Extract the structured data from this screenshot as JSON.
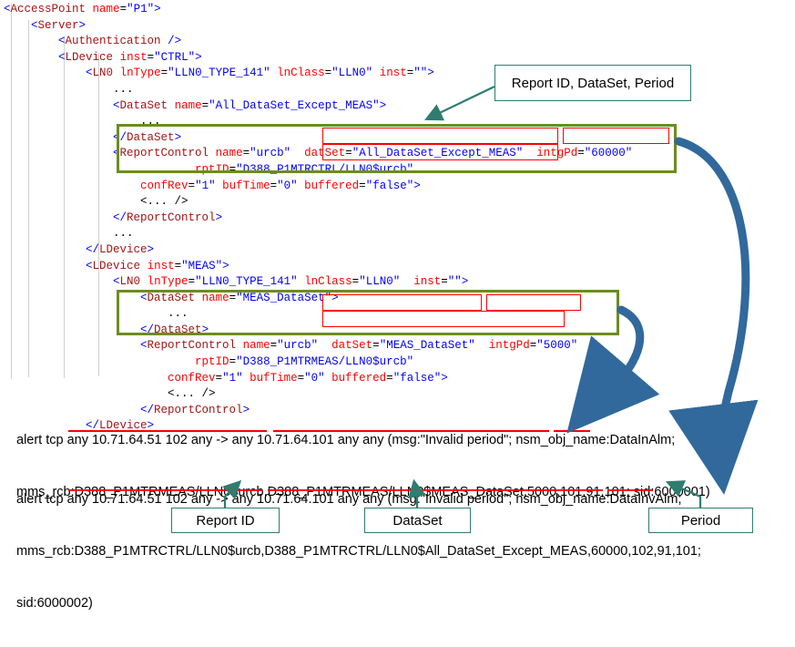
{
  "code_lines": [
    {
      "indent": 0,
      "segments": [
        {
          "t": "<",
          "c": "brk"
        },
        {
          "t": "AccessPoint",
          "c": "tag"
        },
        {
          "t": " ",
          "c": "plain"
        },
        {
          "t": "name",
          "c": "attr"
        },
        {
          "t": "=",
          "c": "plain"
        },
        {
          "t": "\"P1\"",
          "c": "val"
        },
        {
          "t": ">",
          "c": "brk"
        }
      ]
    },
    {
      "indent": 1,
      "segments": [
        {
          "t": "<",
          "c": "brk"
        },
        {
          "t": "Server",
          "c": "tag"
        },
        {
          "t": ">",
          "c": "brk"
        }
      ]
    },
    {
      "indent": 2,
      "segments": [
        {
          "t": "<",
          "c": "brk"
        },
        {
          "t": "Authentication",
          "c": "tag"
        },
        {
          "t": " />",
          "c": "brk"
        }
      ]
    },
    {
      "indent": 2,
      "segments": [
        {
          "t": "<",
          "c": "brk"
        },
        {
          "t": "LDevice",
          "c": "tag"
        },
        {
          "t": " ",
          "c": "plain"
        },
        {
          "t": "inst",
          "c": "attr"
        },
        {
          "t": "=",
          "c": "plain"
        },
        {
          "t": "\"CTRL\"",
          "c": "val"
        },
        {
          "t": ">",
          "c": "brk"
        }
      ]
    },
    {
      "indent": 3,
      "segments": [
        {
          "t": "<",
          "c": "brk"
        },
        {
          "t": "LN0",
          "c": "tag"
        },
        {
          "t": " ",
          "c": "plain"
        },
        {
          "t": "lnType",
          "c": "attr"
        },
        {
          "t": "=",
          "c": "plain"
        },
        {
          "t": "\"LLN0_TYPE_141\"",
          "c": "val"
        },
        {
          "t": " ",
          "c": "plain"
        },
        {
          "t": "lnClass",
          "c": "attr"
        },
        {
          "t": "=",
          "c": "plain"
        },
        {
          "t": "\"LLN0\"",
          "c": "val"
        },
        {
          "t": " ",
          "c": "plain"
        },
        {
          "t": "inst",
          "c": "attr"
        },
        {
          "t": "=",
          "c": "plain"
        },
        {
          "t": "\"\"",
          "c": "val"
        },
        {
          "t": ">",
          "c": "brk"
        }
      ]
    },
    {
      "indent": 4,
      "segments": [
        {
          "t": "...",
          "c": "dots"
        }
      ]
    },
    {
      "indent": 4,
      "segments": [
        {
          "t": "<",
          "c": "brk"
        },
        {
          "t": "DataSet",
          "c": "tag"
        },
        {
          "t": " ",
          "c": "plain"
        },
        {
          "t": "name",
          "c": "attr"
        },
        {
          "t": "=",
          "c": "plain"
        },
        {
          "t": "\"All_DataSet_Except_MEAS\"",
          "c": "val"
        },
        {
          "t": ">",
          "c": "brk"
        }
      ]
    },
    {
      "indent": 5,
      "segments": [
        {
          "t": "...",
          "c": "dots"
        }
      ]
    },
    {
      "indent": 4,
      "segments": [
        {
          "t": "</",
          "c": "brk"
        },
        {
          "t": "DataSet",
          "c": "tag"
        },
        {
          "t": ">",
          "c": "brk"
        }
      ]
    },
    {
      "indent": 4,
      "segments": [
        {
          "t": "<",
          "c": "brk"
        },
        {
          "t": "ReportControl",
          "c": "tag"
        },
        {
          "t": " ",
          "c": "plain"
        },
        {
          "t": "name",
          "c": "attr"
        },
        {
          "t": "=",
          "c": "plain"
        },
        {
          "t": "\"urcb\"",
          "c": "val"
        },
        {
          "t": "  ",
          "c": "plain"
        },
        {
          "t": "datSet",
          "c": "attr"
        },
        {
          "t": "=",
          "c": "plain"
        },
        {
          "t": "\"All_DataSet_Except_MEAS\"",
          "c": "val"
        },
        {
          "t": "  ",
          "c": "plain"
        },
        {
          "t": "intgPd",
          "c": "attr"
        },
        {
          "t": "=",
          "c": "plain"
        },
        {
          "t": "\"60000\"",
          "c": "val"
        }
      ]
    },
    {
      "indent": 7,
      "segments": [
        {
          "t": "rptID",
          "c": "attr"
        },
        {
          "t": "=",
          "c": "plain"
        },
        {
          "t": "\"D388_P1MTRCTRL/LLN0$urcb\"",
          "c": "val"
        }
      ]
    },
    {
      "indent": 5,
      "segments": [
        {
          "t": "confRev",
          "c": "attr"
        },
        {
          "t": "=",
          "c": "plain"
        },
        {
          "t": "\"1\"",
          "c": "val"
        },
        {
          "t": " ",
          "c": "plain"
        },
        {
          "t": "bufTime",
          "c": "attr"
        },
        {
          "t": "=",
          "c": "plain"
        },
        {
          "t": "\"0\"",
          "c": "val"
        },
        {
          "t": " ",
          "c": "plain"
        },
        {
          "t": "buffered",
          "c": "attr"
        },
        {
          "t": "=",
          "c": "plain"
        },
        {
          "t": "\"false\"",
          "c": "val"
        },
        {
          "t": ">",
          "c": "brk"
        }
      ]
    },
    {
      "indent": 5,
      "segments": [
        {
          "t": "<... />",
          "c": "dots"
        }
      ]
    },
    {
      "indent": 4,
      "segments": [
        {
          "t": "</",
          "c": "brk"
        },
        {
          "t": "ReportControl",
          "c": "tag"
        },
        {
          "t": ">",
          "c": "brk"
        }
      ]
    },
    {
      "indent": 4,
      "segments": [
        {
          "t": "...",
          "c": "dots"
        }
      ]
    },
    {
      "indent": 3,
      "segments": [
        {
          "t": "</",
          "c": "brk"
        },
        {
          "t": "LDevice",
          "c": "tag"
        },
        {
          "t": ">",
          "c": "brk"
        }
      ]
    },
    {
      "indent": 3,
      "segments": [
        {
          "t": "<",
          "c": "brk"
        },
        {
          "t": "LDevice",
          "c": "tag"
        },
        {
          "t": " ",
          "c": "plain"
        },
        {
          "t": "inst",
          "c": "attr"
        },
        {
          "t": "=",
          "c": "plain"
        },
        {
          "t": "\"MEAS\"",
          "c": "val"
        },
        {
          "t": ">",
          "c": "brk"
        }
      ]
    },
    {
      "indent": 4,
      "segments": [
        {
          "t": "<",
          "c": "brk"
        },
        {
          "t": "LN0",
          "c": "tag"
        },
        {
          "t": " ",
          "c": "plain"
        },
        {
          "t": "lnType",
          "c": "attr"
        },
        {
          "t": "=",
          "c": "plain"
        },
        {
          "t": "\"LLN0_TYPE_141\"",
          "c": "val"
        },
        {
          "t": " ",
          "c": "plain"
        },
        {
          "t": "lnClass",
          "c": "attr"
        },
        {
          "t": "=",
          "c": "plain"
        },
        {
          "t": "\"LLN0\"",
          "c": "val"
        },
        {
          "t": "  ",
          "c": "plain"
        },
        {
          "t": "inst",
          "c": "attr"
        },
        {
          "t": "=",
          "c": "plain"
        },
        {
          "t": "\"\"",
          "c": "val"
        },
        {
          "t": ">",
          "c": "brk"
        }
      ]
    },
    {
      "indent": 5,
      "segments": [
        {
          "t": "<",
          "c": "brk"
        },
        {
          "t": "DataSet",
          "c": "tag"
        },
        {
          "t": " ",
          "c": "plain"
        },
        {
          "t": "name",
          "c": "attr"
        },
        {
          "t": "=",
          "c": "plain"
        },
        {
          "t": "\"MEAS_DataSet\"",
          "c": "val"
        },
        {
          "t": ">",
          "c": "brk"
        }
      ]
    },
    {
      "indent": 6,
      "segments": [
        {
          "t": "...",
          "c": "dots"
        }
      ]
    },
    {
      "indent": 5,
      "segments": [
        {
          "t": "</",
          "c": "brk"
        },
        {
          "t": "DataSet",
          "c": "tag"
        },
        {
          "t": ">",
          "c": "brk"
        }
      ]
    },
    {
      "indent": 5,
      "segments": [
        {
          "t": "<",
          "c": "brk"
        },
        {
          "t": "ReportControl",
          "c": "tag"
        },
        {
          "t": " ",
          "c": "plain"
        },
        {
          "t": "name",
          "c": "attr"
        },
        {
          "t": "=",
          "c": "plain"
        },
        {
          "t": "\"urcb\"",
          "c": "val"
        },
        {
          "t": "  ",
          "c": "plain"
        },
        {
          "t": "datSet",
          "c": "attr"
        },
        {
          "t": "=",
          "c": "plain"
        },
        {
          "t": "\"MEAS_DataSet\"",
          "c": "val"
        },
        {
          "t": "  ",
          "c": "plain"
        },
        {
          "t": "intgPd",
          "c": "attr"
        },
        {
          "t": "=",
          "c": "plain"
        },
        {
          "t": "\"5000\"",
          "c": "val"
        }
      ]
    },
    {
      "indent": 7,
      "segments": [
        {
          "t": "rptID",
          "c": "attr"
        },
        {
          "t": "=",
          "c": "plain"
        },
        {
          "t": "\"D388_P1MTRMEAS/LLN0$urcb\"",
          "c": "val"
        }
      ]
    },
    {
      "indent": 6,
      "segments": [
        {
          "t": "confRev",
          "c": "attr"
        },
        {
          "t": "=",
          "c": "plain"
        },
        {
          "t": "\"1\"",
          "c": "val"
        },
        {
          "t": " ",
          "c": "plain"
        },
        {
          "t": "bufTime",
          "c": "attr"
        },
        {
          "t": "=",
          "c": "plain"
        },
        {
          "t": "\"0\"",
          "c": "val"
        },
        {
          "t": " ",
          "c": "plain"
        },
        {
          "t": "buffered",
          "c": "attr"
        },
        {
          "t": "=",
          "c": "plain"
        },
        {
          "t": "\"false\"",
          "c": "val"
        },
        {
          "t": ">",
          "c": "brk"
        }
      ]
    },
    {
      "indent": 6,
      "segments": [
        {
          "t": "<... />",
          "c": "dots"
        }
      ]
    },
    {
      "indent": 5,
      "segments": [
        {
          "t": "</",
          "c": "brk"
        },
        {
          "t": "ReportControl",
          "c": "tag"
        },
        {
          "t": ">",
          "c": "brk"
        }
      ]
    },
    {
      "indent": 3,
      "segments": [
        {
          "t": "</",
          "c": "brk"
        },
        {
          "t": "LDevice",
          "c": "tag"
        },
        {
          "t": ">",
          "c": "brk"
        }
      ]
    }
  ],
  "callouts": {
    "top": "Report ID, DataSet, Period",
    "report_id": "Report ID",
    "dataset": "DataSet",
    "period": "Period"
  },
  "rules": [
    {
      "id": "rule-1",
      "line1": "alert tcp any 10.71.64.51 102 any -> any 10.71.64.101 any any (msg:\"Invalid period\"; nsm_obj_name:DataInAlm;",
      "line2": "mms_rcb:D388_P1MTRMEAS/LLN0$urcb,D388_P1MTRMEAS/LLN0$MEAS_DataSet,5000,101,91,101; sid:6000001)"
    },
    {
      "id": "rule-2",
      "line1": "alert tcp any 10.71.64.51 102 any -> any 10.71.64.101 any any (msg:\"Invalid period\"; nsm_obj_name:DataInvAlm;",
      "line2": "mms_rcb:D388_P1MTRCTRL/LLN0$urcb,D388_P1MTRCTRL/LLN0$All_DataSet_Except_MEAS,60000,102,91,101;",
      "line3": "sid:6000002)"
    }
  ],
  "colors": {
    "green_box": "#6d8c1f",
    "red_box": "#ff0000",
    "label_border": "#2e7d6e",
    "arrow": "#31699c",
    "xml_tag": "#a31515",
    "xml_attr": "#ff0000",
    "xml_value": "#0000ff"
  }
}
